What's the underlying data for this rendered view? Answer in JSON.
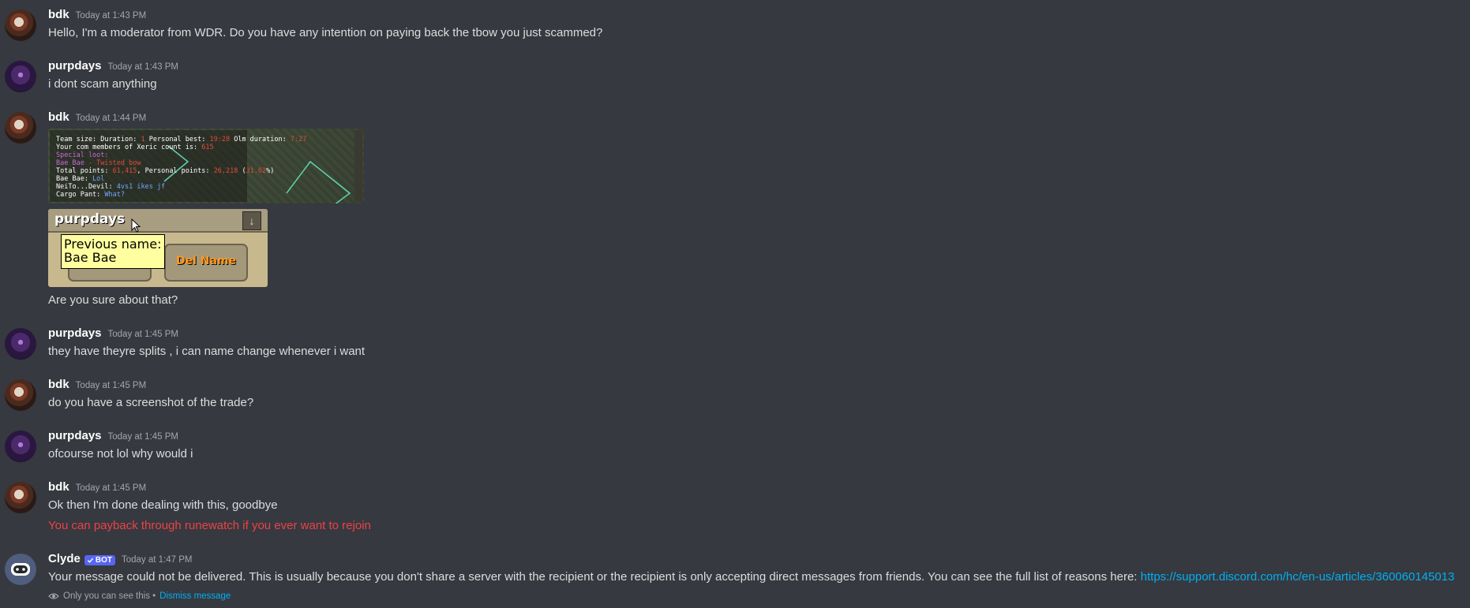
{
  "messages": [
    {
      "username": "bdk",
      "timestamp": "Today at 1:43 PM",
      "text": "Hello, I'm a moderator from WDR. Do you have any intention on paying back the tbow you just scammed?"
    },
    {
      "username": "purpdays",
      "timestamp": "Today at 1:43 PM",
      "text": "i dont scam anything"
    },
    {
      "username": "bdk",
      "timestamp": "Today at 1:44 PM",
      "text": "Are you sure about that?"
    },
    {
      "username": "purpdays",
      "timestamp": "Today at 1:45 PM",
      "text": "they have theyre splits , i can name change whenever i want"
    },
    {
      "username": "bdk",
      "timestamp": "Today at 1:45 PM",
      "text": "do you have a screenshot of the trade?"
    },
    {
      "username": "purpdays",
      "timestamp": "Today at 1:45 PM",
      "text": "ofcourse not lol why would i"
    },
    {
      "username": "bdk",
      "timestamp": "Today at 1:45 PM",
      "text": "Ok then I'm done dealing with this, goodbye",
      "text2": "You can payback through runewatch if you ever want to rejoin"
    },
    {
      "username": "Clyde",
      "bot_tag": "BOT",
      "timestamp": "Today at 1:47 PM",
      "text": "Your message could not be delivered. This is usually because you don't share a server with the recipient or the recipient is only accepting direct messages from friends. You can see the full list of reasons here: ",
      "link": "https://support.discord.com/hc/en-us/articles/360060145013",
      "ephemeral_note": "Only you can see this •",
      "dismiss_label": "Dismiss message"
    }
  ],
  "attachment_1": {
    "lines": [
      [
        "Team size: ",
        "",
        "Duration: ",
        "",
        "Personal best: ",
        "19:28",
        " Olm duration: ",
        "7:27"
      ],
      [
        "Your com",
        "",
        " members of Xeric count is: ",
        "615"
      ],
      [
        "Special loot:"
      ],
      [
        "Bae Bae",
        " - Twisted bow"
      ],
      [
        "Total points: ",
        "61,415",
        ", Personal points: ",
        "26,218",
        " (",
        "31.62",
        "%)"
      ],
      [
        "Bae Bae: ",
        "Lol",
        ""
      ],
      [
        "NeiTo...Devil: ",
        "4vs1 ikes jf"
      ],
      [
        "Cargo Pant: ",
        "What?"
      ]
    ]
  },
  "attachment_2": {
    "name": "purpdays",
    "tooltip_line1": "Previous name:",
    "tooltip_line2": "Bae Bae",
    "del_button": "Del Name"
  },
  "colors": {
    "background": "#36393f",
    "text": "#dcddde",
    "username": "#ffffff",
    "timestamp": "#a3a6aa",
    "red_text": "#ed4245",
    "link": "#00aff4",
    "bot_tag": "#5865f2"
  }
}
